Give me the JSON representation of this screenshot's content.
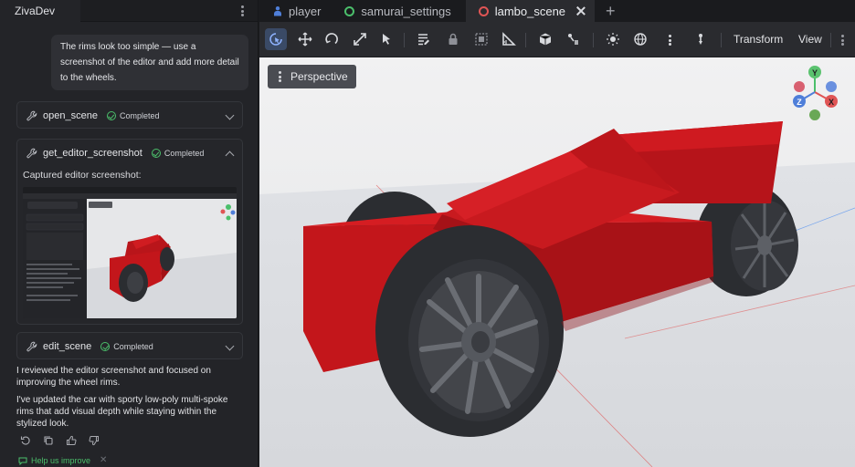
{
  "left_panel": {
    "tab_title": "ZivaDev",
    "user_message": "The rims look too simple — use a screenshot of the editor and add more detail to the wheels.",
    "tool_calls": [
      {
        "name": "open_scene",
        "status": "Completed"
      },
      {
        "name": "get_editor_screenshot",
        "status": "Completed",
        "caption": "Captured editor screenshot:"
      },
      {
        "name": "edit_scene",
        "status": "Completed"
      }
    ],
    "reply_1": "I reviewed the editor screenshot and focused on improving the wheel rims.",
    "reply_2": "I've updated the car with sporty low-poly multi-spoke rims that add visual depth while staying within the stylized look.",
    "help_link": "Help us improve"
  },
  "tabs": [
    {
      "label": "player",
      "icon": "person-icon",
      "color": "#4f7fd9"
    },
    {
      "label": "samurai_settings",
      "icon": "circle-icon",
      "color": "#4bbf6b"
    },
    {
      "label": "lambo_scene",
      "icon": "circle-icon",
      "color": "#e05555"
    }
  ],
  "toolbar": {
    "transform_label": "Transform",
    "view_label": "View"
  },
  "viewport": {
    "projection_label": "Perspective",
    "gizmo": {
      "y": "Y",
      "z": "Z",
      "x": "X"
    },
    "colors": {
      "car_body": "#c3161b",
      "tire": "#2b2d31",
      "rim": "#6a6d73",
      "floor": "#dfe1e5",
      "sky": "#e9eaec"
    }
  }
}
